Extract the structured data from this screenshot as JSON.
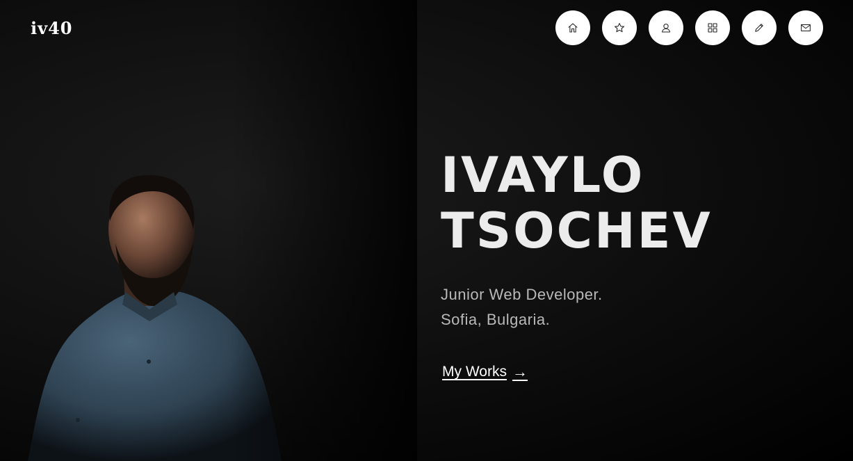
{
  "brand": {
    "logo_text": "iv40"
  },
  "nav": {
    "items": [
      {
        "name": "home",
        "icon": "home-icon"
      },
      {
        "name": "star",
        "icon": "star-icon"
      },
      {
        "name": "user",
        "icon": "user-icon"
      },
      {
        "name": "grid",
        "icon": "grid-icon"
      },
      {
        "name": "pencil",
        "icon": "pencil-icon"
      },
      {
        "name": "mail",
        "icon": "mail-icon"
      }
    ]
  },
  "hero": {
    "first_name": "IVAYLO",
    "last_name": "TSOCHEV",
    "role": "Junior Web Developer.",
    "location": "Sofia, Bulgaria.",
    "cta_label": "My Works",
    "cta_arrow": "→"
  },
  "colors": {
    "background": "#000000",
    "nav_button": "#ffffff",
    "heading": "#ececec",
    "tagline": "#b9b9b9"
  }
}
